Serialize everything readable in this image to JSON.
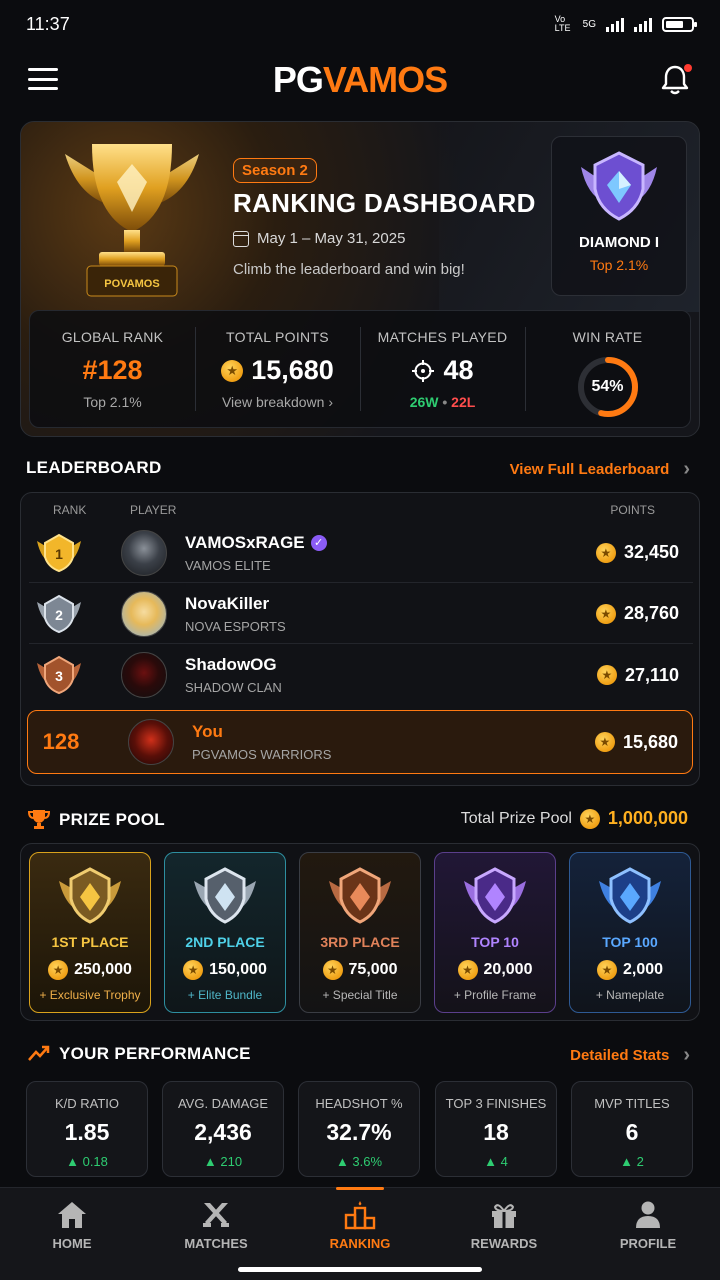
{
  "status": {
    "time": "11:37",
    "net1": "Vo LTE",
    "net2": "5G"
  },
  "header": {
    "logo_pg": "PG",
    "logo_vamos": "VAMOS"
  },
  "hero": {
    "season": "Season 2",
    "title": "RANKING DASHBOARD",
    "dates": "May 1 – May 31, 2025",
    "subtitle": "Climb the leaderboard and win big!",
    "trophy_text": "POVAMOS",
    "rank_name": "DIAMOND I",
    "rank_top": "Top 2.1%"
  },
  "stats": {
    "global_rank_label": "GLOBAL RANK",
    "global_rank": "#128",
    "global_rank_foot": "Top 2.1%",
    "points_label": "TOTAL POINTS",
    "points": "15,680",
    "points_foot": "View breakdown",
    "matches_label": "MATCHES PLAYED",
    "matches": "48",
    "wins": "26W",
    "sep": "•",
    "losses": "22L",
    "winrate_label": "WIN RATE",
    "winrate": "54%",
    "winrate_value": 0.54
  },
  "leaderboard": {
    "title": "LEADERBOARD",
    "link": "View Full Leaderboard",
    "col_rank": "RANK",
    "col_player": "PLAYER",
    "col_points": "POINTS",
    "rows": [
      {
        "rank": "1",
        "name": "VAMOSxRAGE",
        "team": "VAMOS ELITE",
        "points": "32,450"
      },
      {
        "rank": "2",
        "name": "NovaKiller",
        "team": "NOVA ESPORTS",
        "points": "28,760"
      },
      {
        "rank": "3",
        "name": "ShadowOG",
        "team": "SHADOW CLAN",
        "points": "27,110"
      }
    ],
    "you": {
      "rank": "128",
      "name": "You",
      "team": "PGVAMOS WARRIORS",
      "points": "15,680"
    }
  },
  "prize_pool": {
    "title": "PRIZE POOL",
    "total_label": "Total Prize Pool",
    "total": "1,000,000",
    "prizes": [
      {
        "name": "1ST PLACE",
        "amount": "250,000",
        "extra": "+ Exclusive Trophy",
        "color": "#f5c542"
      },
      {
        "name": "2ND PLACE",
        "amount": "150,000",
        "extra": "+ Elite Bundle",
        "color": "#4fd1e8"
      },
      {
        "name": "3RD PLACE",
        "amount": "75,000",
        "extra": "+ Special Title",
        "color": "#e0825a"
      },
      {
        "name": "TOP 10",
        "amount": "20,000",
        "extra": "+ Profile Frame",
        "color": "#b084ff"
      },
      {
        "name": "TOP 100",
        "amount": "2,000",
        "extra": "+ Nameplate",
        "color": "#5aa8ff"
      }
    ]
  },
  "performance": {
    "title": "YOUR PERFORMANCE",
    "link": "Detailed Stats",
    "items": [
      {
        "label": "K/D RATIO",
        "value": "1.85",
        "delta": "▲ 0.18"
      },
      {
        "label": "AVG. DAMAGE",
        "value": "2,436",
        "delta": "▲ 210"
      },
      {
        "label": "HEADSHOT %",
        "value": "32.7%",
        "delta": "▲ 3.6%"
      },
      {
        "label": "TOP 3 FINISHES",
        "value": "18",
        "delta": "▲ 4"
      },
      {
        "label": "MVP TITLES",
        "value": "6",
        "delta": "▲ 2"
      }
    ]
  },
  "nav": {
    "home": "HOME",
    "matches": "MATCHES",
    "ranking": "RANKING",
    "rewards": "REWARDS",
    "profile": "PROFILE"
  }
}
